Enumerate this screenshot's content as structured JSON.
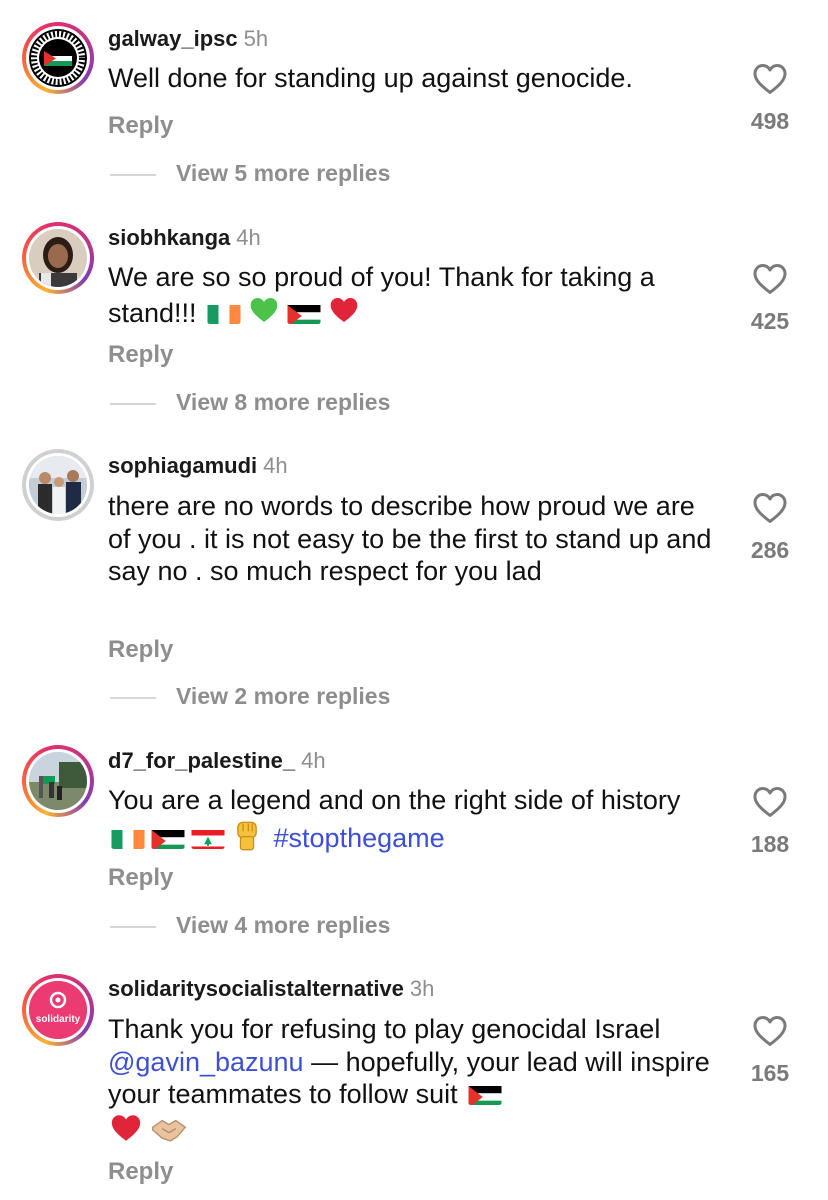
{
  "comments": [
    {
      "username": "galway_ipsc",
      "time": "5h",
      "text": "Well done for standing up against genocide.",
      "reply_label": "Reply",
      "likes": "498",
      "view_more": "View 5 more replies",
      "avatar_icon": "palestine-solidarity-badge"
    },
    {
      "username": "siobhkanga",
      "time": "4h",
      "text_part1": "We are so so proud of you! Thank for taking a stand!!!",
      "emojis": [
        "ireland-flag",
        "green-heart",
        "palestine-flag",
        "red-heart"
      ],
      "reply_label": "Reply",
      "likes": "425",
      "view_more": "View 8 more replies",
      "avatar_icon": "profile-photo"
    },
    {
      "username": "sophiagamudi",
      "time": "4h",
      "text": "there are no words to describe how proud we are of you . it is not easy to be the first to stand up and say no . so much respect for you lad",
      "reply_label": "Reply",
      "likes": "286",
      "view_more": "View 2 more replies",
      "avatar_icon": "group-photo"
    },
    {
      "username": "d7_for_palestine_",
      "time": "4h",
      "text_part1": "You are a legend and on the right side of history",
      "emojis": [
        "ireland-flag",
        "palestine-flag",
        "lebanon-flag",
        "raised-fist"
      ],
      "hashtag": "#stopthegame",
      "reply_label": "Reply",
      "likes": "188",
      "view_more": "View 4 more replies",
      "avatar_icon": "street-photo"
    },
    {
      "username": "solidaritysocialistalternative",
      "time": "3h",
      "text_part1": "Thank you for refusing to play genocidal Israel",
      "mention": "@gavin_bazunu",
      "text_part2": "— hopefully, your lead will inspire your teammates to follow suit",
      "emojis": [
        "palestine-flag",
        "red-heart",
        "handshake"
      ],
      "reply_label": "Reply",
      "likes": "165",
      "avatar_text": "solidarity",
      "avatar_icon": "solidarity-logo"
    }
  ],
  "colors": {
    "text": "#111111",
    "muted": "#8e8e8e",
    "link": "#3d4fd6",
    "story_ring": "#e1306c"
  }
}
